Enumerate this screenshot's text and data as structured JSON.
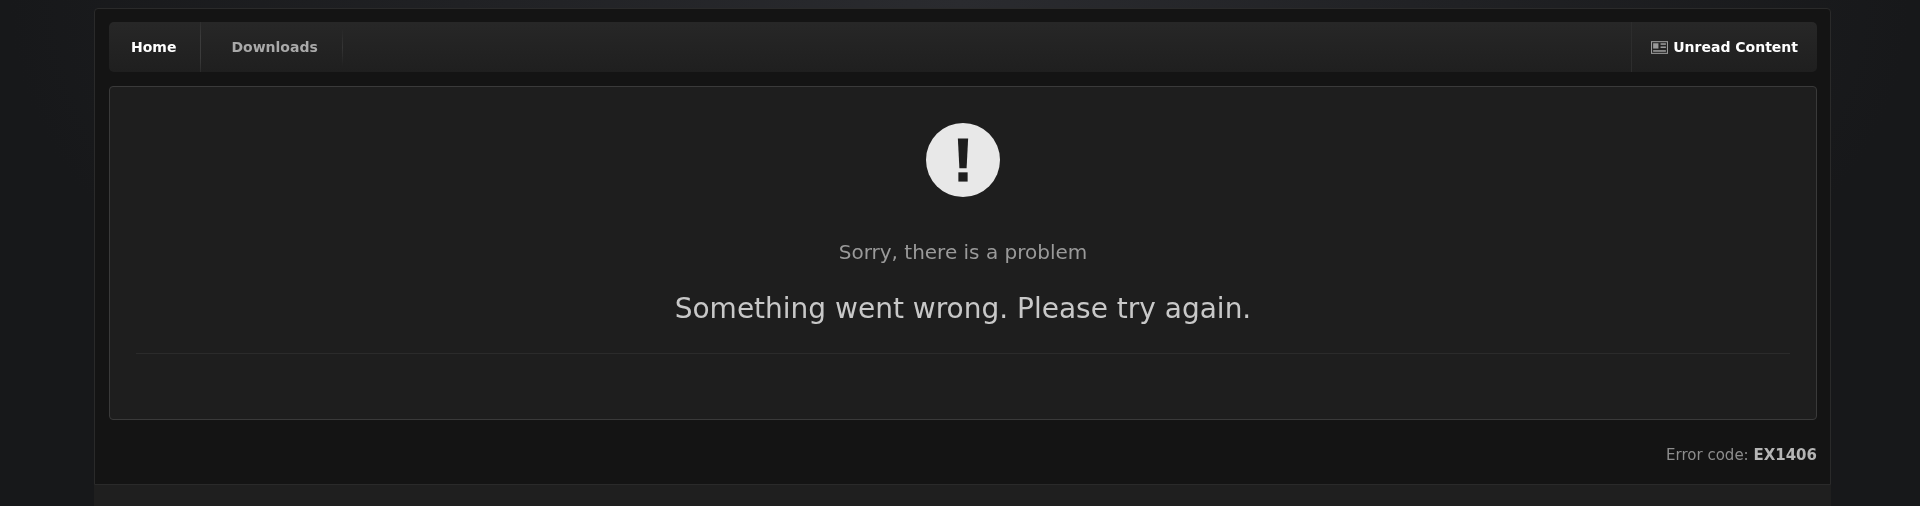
{
  "breadcrumb": {
    "items": [
      {
        "label": "Home",
        "selected": true
      },
      {
        "label": "Downloads",
        "selected": false
      }
    ],
    "link": {
      "label": "Unread Content"
    }
  },
  "error": {
    "title": "Sorry, there is a problem",
    "message": "Something went wrong. Please try again."
  },
  "footer": {
    "code": "Error code: **EX1406**"
  }
}
